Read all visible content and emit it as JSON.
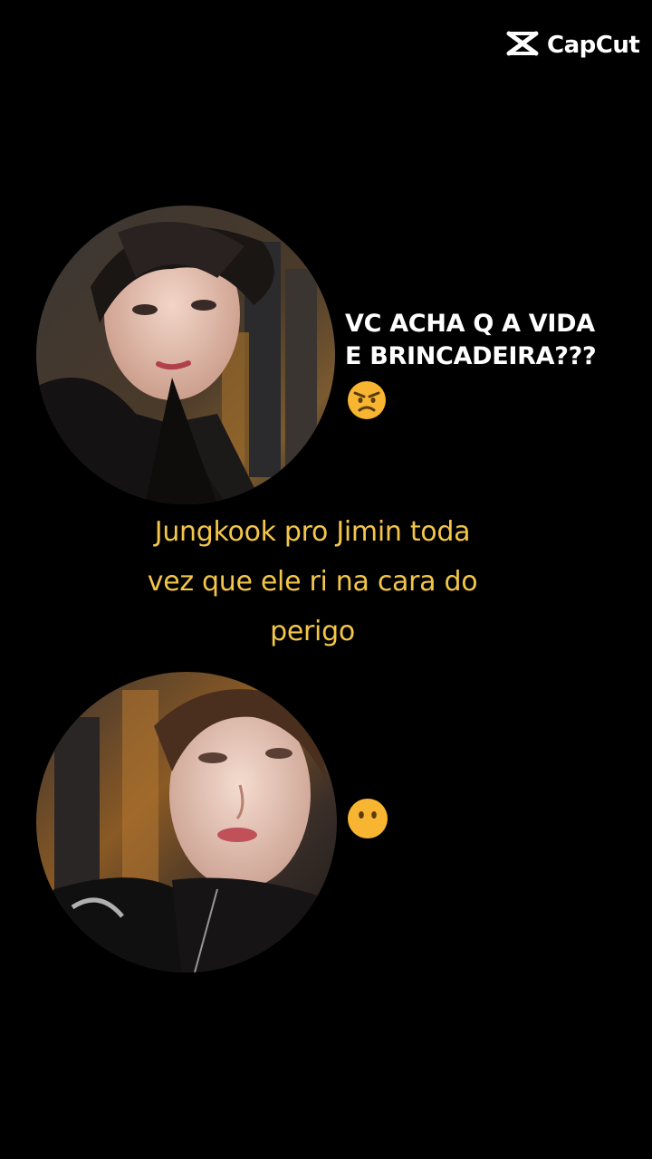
{
  "watermark": {
    "brand": "CapCut",
    "icon": "capcut-logo-icon"
  },
  "colors": {
    "background": "#000000",
    "caption": "#f3c649",
    "text": "#ffffff",
    "emoji_face": "#f7b531"
  },
  "top_panel": {
    "shout_line1": "VC ACHA Q A VIDA",
    "shout_line2": "E BRINCADEIRA???",
    "emoji": "angry-face-emoji"
  },
  "caption": {
    "line1": "Jungkook pro Jimin toda",
    "line2": "vez que ele ri na cara do",
    "line3": "perigo"
  },
  "bottom_panel": {
    "emoji": "face-without-mouth-emoji"
  }
}
